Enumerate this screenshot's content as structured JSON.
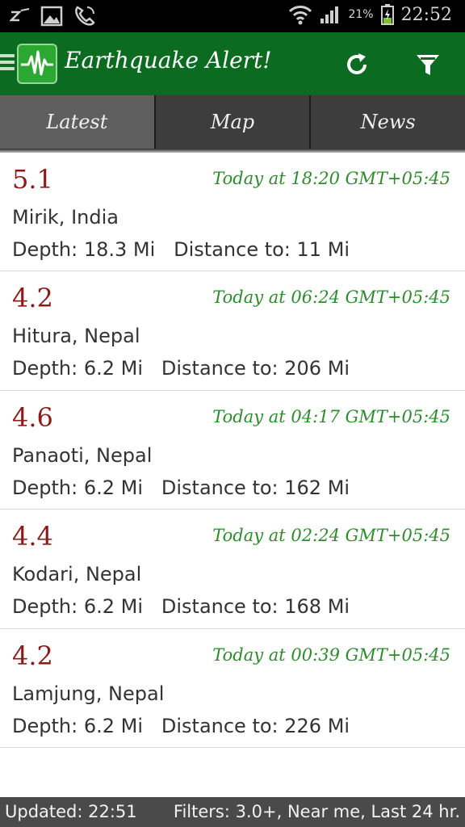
{
  "status_bar": {
    "battery_percent": "21%",
    "time": "22:52",
    "icons": [
      "missed-call-icon",
      "gallery-icon",
      "call-icon",
      "wifi-icon",
      "signal-icon",
      "battery-charging-icon"
    ]
  },
  "app_bar": {
    "title": "Earthquake Alert!",
    "icons": [
      "menu-icon",
      "app-logo-icon",
      "refresh-icon",
      "filter-icon"
    ]
  },
  "tabs": [
    {
      "label": "Latest",
      "active": true
    },
    {
      "label": "Map",
      "active": false
    },
    {
      "label": "News",
      "active": false
    }
  ],
  "quakes": [
    {
      "magnitude": "5.1",
      "time": "Today at 18:20 GMT+05:45",
      "place": "Mirik, India",
      "details": "Depth: 18.3 Mi   Distance to: 11 Mi"
    },
    {
      "magnitude": "4.2",
      "time": "Today at 06:24 GMT+05:45",
      "place": "Hitura, Nepal",
      "details": "Depth: 6.2 Mi   Distance to: 206 Mi"
    },
    {
      "magnitude": "4.6",
      "time": "Today at 04:17 GMT+05:45",
      "place": "Panaoti, Nepal",
      "details": "Depth: 6.2 Mi   Distance to: 162 Mi"
    },
    {
      "magnitude": "4.4",
      "time": "Today at 02:24 GMT+05:45",
      "place": "Kodari, Nepal",
      "details": "Depth: 6.2 Mi   Distance to: 168 Mi"
    },
    {
      "magnitude": "4.2",
      "time": "Today at 00:39 GMT+05:45",
      "place": "Lamjung, Nepal",
      "details": "Depth: 6.2 Mi   Distance to: 226 Mi"
    }
  ],
  "footer": {
    "updated": "Updated: 22:51",
    "filters": "Filters: 3.0+, Near me, Last 24 hr."
  },
  "colors": {
    "app_bar": "#0b6b21",
    "magnitude": "#8b1a1a",
    "time": "#2e8b2e",
    "footer": "#4a4a4a"
  }
}
